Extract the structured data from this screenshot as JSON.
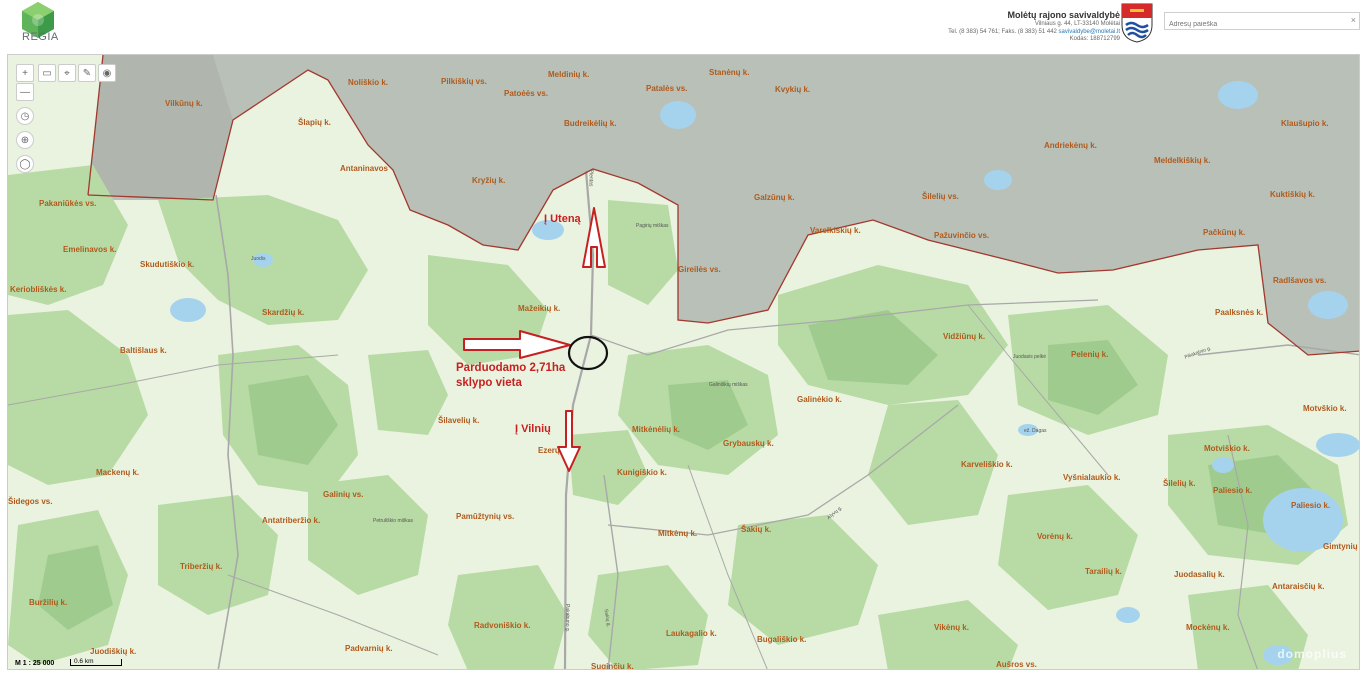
{
  "header": {
    "logo_text": "REGIA",
    "municipality_name": "Molėtų rajono savivaldybė",
    "address": "Vilniaus g. 44, LT-33140 Molėtai",
    "phone": "Tel. (8 383) 54 761; Faks. (8 383) 51 442",
    "email": "savivaldybe@moletai.lt",
    "code": "Kodas: 188712799",
    "search_placeholder": "Adresų paieška",
    "search_clear": "×"
  },
  "toolbar": {
    "zoom_in": "+",
    "zoom_out": "—"
  },
  "map": {
    "colors": {
      "field": "#eaf3df",
      "forest": "#b9dca7",
      "forest_dark": "#99c98a",
      "water": "#a7d4ee",
      "grey_zone": "#b3b9b1",
      "boundary": "#a2382e",
      "road": "#a8a8a8",
      "annotation": "#c62020"
    },
    "places": [
      {
        "name": "Vilkūnų k."
      },
      {
        "name": "Noliškio k."
      },
      {
        "name": "Pilkiškių vs."
      },
      {
        "name": "Patoėės vs."
      },
      {
        "name": "Meldinių k."
      },
      {
        "name": "Budreikėlių k."
      },
      {
        "name": "Patalės vs."
      },
      {
        "name": "Stanėnų k."
      },
      {
        "name": "Kvykių k."
      },
      {
        "name": "Šlapių k."
      },
      {
        "name": "Antaninavos"
      },
      {
        "name": "Kryžių k."
      },
      {
        "name": "Galzūnų k."
      },
      {
        "name": "Šilelių vs."
      },
      {
        "name": "Andriekėnų k."
      },
      {
        "name": "Meldelkiškių k."
      },
      {
        "name": "Kuktiškių k."
      },
      {
        "name": "Klaušupio k."
      },
      {
        "name": "Pakaniūkės vs."
      },
      {
        "name": "Emelinavos k."
      },
      {
        "name": "Skudutiškio k."
      },
      {
        "name": "Varelkiškių k."
      },
      {
        "name": "Pažuvinčio vs."
      },
      {
        "name": "Pačkūnų k."
      },
      {
        "name": "Radlšavos vs."
      },
      {
        "name": "Keriobliškės k."
      },
      {
        "name": "Skardžių k."
      },
      {
        "name": "Mažeikių k."
      },
      {
        "name": "Gireilės vs."
      },
      {
        "name": "Paalksnės k."
      },
      {
        "name": "Baltišlaus k."
      },
      {
        "name": "Vidžiūnų k."
      },
      {
        "name": "Pelenių k."
      },
      {
        "name": "Galinėkio k."
      },
      {
        "name": "Motvškio k."
      },
      {
        "name": "Šilavelių k."
      },
      {
        "name": "Mitkėnėlių k."
      },
      {
        "name": "Grybauskų k."
      },
      {
        "name": "Motviškio k."
      },
      {
        "name": "Mackenų k."
      },
      {
        "name": "Ezerų k."
      },
      {
        "name": "Kunigiškio k."
      },
      {
        "name": "Karveliškio k."
      },
      {
        "name": "Vyšnialaukio k."
      },
      {
        "name": "Šilelių k."
      },
      {
        "name": "Paliesio k."
      },
      {
        "name": "Šidegos vs."
      },
      {
        "name": "Galinių vs."
      },
      {
        "name": "Paliesio k."
      },
      {
        "name": "Antatriberžio k."
      },
      {
        "name": "Pamūžtynių vs."
      },
      {
        "name": "Mitkėnų k."
      },
      {
        "name": "Šakių k."
      },
      {
        "name": "Vorėnų k."
      },
      {
        "name": "Gimtynių"
      },
      {
        "name": "Triberžių k."
      },
      {
        "name": "Tarailių k."
      },
      {
        "name": "Juodasalių k."
      },
      {
        "name": "Antaraisčių k."
      },
      {
        "name": "Buržilių k."
      },
      {
        "name": "Radvoniškio k."
      },
      {
        "name": "Laukagalio k."
      },
      {
        "name": "Bugališkio k."
      },
      {
        "name": "Vikėnų k."
      },
      {
        "name": "Mockėnų k."
      },
      {
        "name": "Juodiškių k."
      },
      {
        "name": "Padvarnių k."
      },
      {
        "name": "Suginčių k."
      },
      {
        "name": "Aušros vs."
      }
    ],
    "minor_labels": [
      {
        "name": "Juodis"
      },
      {
        "name": "Juodis"
      },
      {
        "name": "ež. Dagas"
      },
      {
        "name": "Juodasis pelkė"
      },
      {
        "name": "Pagirių miškas"
      },
      {
        "name": "Galiniškių miškas"
      },
      {
        "name": "Petruliškio miškas"
      },
      {
        "name": "Plentas"
      },
      {
        "name": "Alyvų g."
      },
      {
        "name": "Piliakalnio g."
      },
      {
        "name": "Pakabuno g."
      },
      {
        "name": "Sakių g."
      }
    ],
    "annotations": {
      "up_label": "Į Uteną",
      "plot_label_1": "Parduodamo 2,71ha",
      "plot_label_2": "sklypo vieta",
      "down_label": "Į Vilnių"
    },
    "scale_text": "M 1 : 25 000",
    "scale_bar": "0.6 km",
    "watermark": "domoplius"
  }
}
